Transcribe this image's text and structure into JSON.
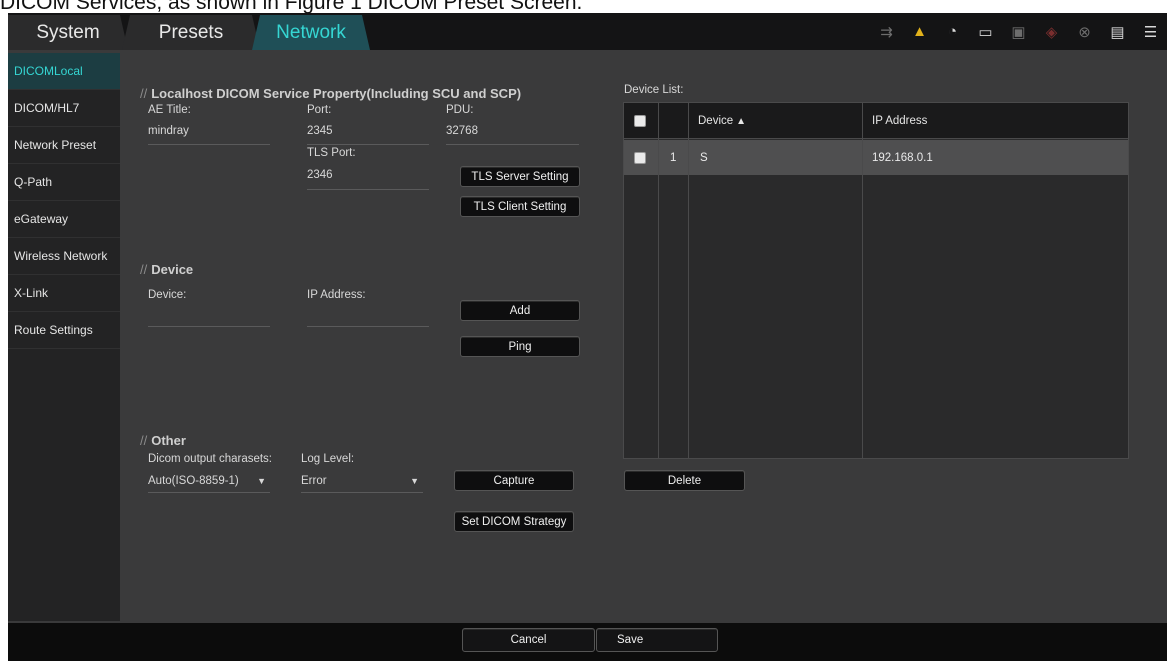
{
  "caption": "DICOM Services, as shown in Figure 1 DICOM Preset Screen.",
  "tabs": [
    {
      "label": "System"
    },
    {
      "label": "Presets"
    },
    {
      "label": "Network"
    }
  ],
  "sidebar": {
    "items": [
      {
        "label": "DICOMLocal"
      },
      {
        "label": "DICOM/HL7"
      },
      {
        "label": "Network Preset"
      },
      {
        "label": "Q-Path"
      },
      {
        "label": "eGateway"
      },
      {
        "label": "Wireless Network"
      },
      {
        "label": "X-Link"
      },
      {
        "label": "Route Settings"
      }
    ]
  },
  "localhost": {
    "title": "Localhost DICOM Service Property(Including SCU and SCP)",
    "ae_title_label": "AE Title:",
    "ae_title_value": "mindray",
    "port_label": "Port:",
    "port_value": "2345",
    "pdu_label": "PDU:",
    "pdu_value": "32768",
    "tls_port_label": "TLS Port:",
    "tls_port_value": "2346",
    "tls_server_button": "TLS Server Setting",
    "tls_client_button": "TLS Client Setting"
  },
  "device": {
    "title": "Device",
    "device_label": "Device:",
    "ip_label": "IP Address:",
    "add_button": "Add",
    "ping_button": "Ping"
  },
  "other": {
    "title": "Other",
    "charset_label": "Dicom output charasets:",
    "charset_value": "Auto(ISO-8859-1)",
    "log_label": "Log Level:",
    "log_value": "Error",
    "capture_button": "Capture",
    "strategy_button": "Set DICOM Strategy"
  },
  "device_list": {
    "label": "Device List:",
    "columns": {
      "device": "Device",
      "ip": "IP Address"
    },
    "rows": [
      {
        "index": "1",
        "device": "S",
        "ip": "192.168.0.1"
      }
    ],
    "delete_button": "Delete"
  },
  "footer": {
    "cancel_button": "Cancel",
    "save_button": "Save"
  }
}
